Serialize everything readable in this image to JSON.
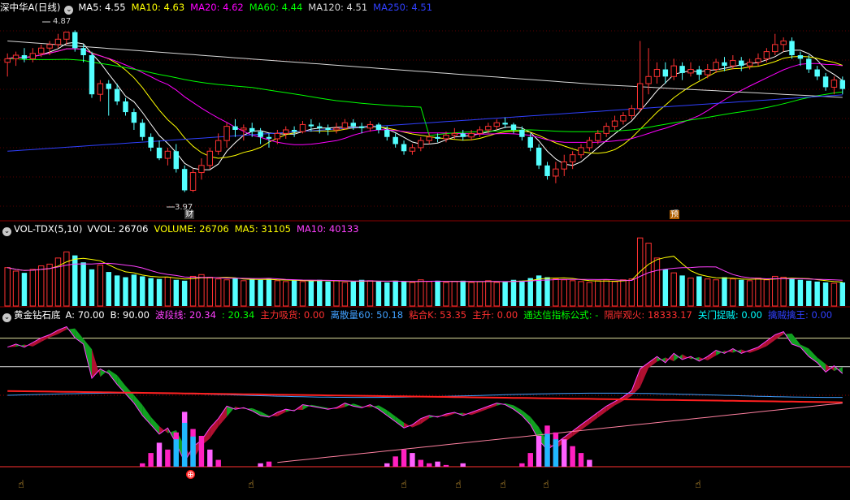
{
  "price_panel": {
    "title": "深中华A(日线)",
    "ma": [
      {
        "label": "MA5: 4.55",
        "color": "#ffffff"
      },
      {
        "label": "MA10: 4.63",
        "color": "#ffff00"
      },
      {
        "label": "MA20: 4.62",
        "color": "#ff00ff"
      },
      {
        "label": "MA60: 4.44",
        "color": "#00ff00"
      },
      {
        "label": "MA120: 4.51",
        "color": "#d8d8d8"
      },
      {
        "label": "MA250: 4.51",
        "color": "#3040ff"
      }
    ],
    "high_label": "4.87",
    "low_label": "3.97",
    "marker_cai": "财",
    "marker_yu": "预"
  },
  "volume_panel": {
    "name": "VOL-TDX(5,10)",
    "vvol": "VVOL: 26706",
    "volume": "VOLUME: 26706",
    "ma5": "MA5: 31105",
    "ma10": "MA10: 40133"
  },
  "indicator_panel": {
    "name": "黄金钻石底",
    "items": [
      {
        "label": "A: 70.00",
        "color": "#ffffff"
      },
      {
        "label": "B: 90.00",
        "color": "#ffffff"
      },
      {
        "label": "波段线: 20.34",
        "color": "#ff40ff"
      },
      {
        "label": ": 20.34",
        "color": "#00ff00"
      },
      {
        "label": "主力吸货: 0.00",
        "color": "#ff3030"
      },
      {
        "label": "离散量60: 50.18",
        "color": "#40a0ff"
      },
      {
        "label": "粘合K: 53.35",
        "color": "#ff3030"
      },
      {
        "label": "主升: 0.00",
        "color": "#ff3030"
      },
      {
        "label": "通达信指标公式: -",
        "color": "#00ff00"
      },
      {
        "label": "隔岸观火: 18333.17",
        "color": "#ff3030"
      },
      {
        "label": "关门捉贼: 0.00",
        "color": "#00ffff"
      },
      {
        "label": "擒贼擒王: 0.00",
        "color": "#3040ff"
      }
    ]
  },
  "colors": {
    "up": "#ff3232",
    "down": "#54ffff",
    "axis": "#8b0000"
  },
  "chart_data": {
    "type": "candlestick",
    "candles": [
      [
        4.7,
        4.72,
        4.62,
        4.75
      ],
      [
        4.72,
        4.74,
        4.68,
        4.76
      ],
      [
        4.74,
        4.72,
        4.7,
        4.78
      ],
      [
        4.72,
        4.75,
        4.7,
        4.78
      ],
      [
        4.75,
        4.78,
        4.73,
        4.8
      ],
      [
        4.78,
        4.8,
        4.74,
        4.82
      ],
      [
        4.8,
        4.83,
        4.78,
        4.86
      ],
      [
        4.83,
        4.87,
        4.8,
        4.87
      ],
      [
        4.87,
        4.78,
        4.76,
        4.88
      ],
      [
        4.78,
        4.74,
        4.7,
        4.8
      ],
      [
        4.74,
        4.52,
        4.5,
        4.76
      ],
      [
        4.52,
        4.58,
        4.48,
        4.6
      ],
      [
        4.58,
        4.55,
        4.4,
        4.6
      ],
      [
        4.55,
        4.48,
        4.46,
        4.58
      ],
      [
        4.48,
        4.42,
        4.4,
        4.5
      ],
      [
        4.42,
        4.36,
        4.32,
        4.44
      ],
      [
        4.36,
        4.28,
        4.26,
        4.38
      ],
      [
        4.28,
        4.22,
        4.2,
        4.3
      ],
      [
        4.22,
        4.16,
        4.15,
        4.26
      ],
      [
        4.16,
        4.2,
        4.12,
        4.22
      ],
      [
        4.2,
        4.1,
        4.08,
        4.24
      ],
      [
        4.1,
        3.98,
        3.97,
        4.12
      ],
      [
        3.98,
        4.08,
        3.97,
        4.1
      ],
      [
        4.08,
        4.12,
        4.04,
        4.16
      ],
      [
        4.12,
        4.2,
        4.1,
        4.22
      ],
      [
        4.2,
        4.26,
        4.18,
        4.3
      ],
      [
        4.26,
        4.34,
        4.22,
        4.36
      ],
      [
        4.34,
        4.32,
        4.28,
        4.38
      ],
      [
        4.32,
        4.33,
        4.26,
        4.35
      ],
      [
        4.33,
        4.31,
        4.28,
        4.36
      ],
      [
        4.31,
        4.28,
        4.24,
        4.33
      ],
      [
        4.28,
        4.27,
        4.22,
        4.3
      ],
      [
        4.27,
        4.3,
        4.24,
        4.32
      ],
      [
        4.3,
        4.32,
        4.27,
        4.34
      ],
      [
        4.32,
        4.31,
        4.28,
        4.34
      ],
      [
        4.31,
        4.35,
        4.3,
        4.37
      ],
      [
        4.35,
        4.34,
        4.31,
        4.38
      ],
      [
        4.34,
        4.33,
        4.3,
        4.36
      ],
      [
        4.33,
        4.32,
        4.29,
        4.35
      ],
      [
        4.32,
        4.33,
        4.3,
        4.36
      ],
      [
        4.33,
        4.36,
        4.32,
        4.38
      ],
      [
        4.36,
        4.34,
        4.32,
        4.38
      ],
      [
        4.34,
        4.33,
        4.3,
        4.36
      ],
      [
        4.33,
        4.35,
        4.31,
        4.37
      ],
      [
        4.35,
        4.32,
        4.3,
        4.36
      ],
      [
        4.32,
        4.28,
        4.26,
        4.34
      ],
      [
        4.28,
        4.24,
        4.22,
        4.3
      ],
      [
        4.24,
        4.2,
        4.18,
        4.26
      ],
      [
        4.2,
        4.22,
        4.18,
        4.24
      ],
      [
        4.22,
        4.26,
        4.2,
        4.28
      ],
      [
        4.26,
        4.28,
        4.24,
        4.3
      ],
      [
        4.28,
        4.27,
        4.25,
        4.3
      ],
      [
        4.27,
        4.29,
        4.25,
        4.31
      ],
      [
        4.29,
        4.3,
        4.27,
        4.33
      ],
      [
        4.3,
        4.28,
        4.26,
        4.32
      ],
      [
        4.28,
        4.3,
        4.26,
        4.32
      ],
      [
        4.3,
        4.32,
        4.28,
        4.34
      ],
      [
        4.32,
        4.34,
        4.3,
        4.36
      ],
      [
        4.34,
        4.36,
        4.32,
        4.38
      ],
      [
        4.36,
        4.35,
        4.33,
        4.39
      ],
      [
        4.35,
        4.32,
        4.3,
        4.36
      ],
      [
        4.32,
        4.28,
        4.26,
        4.34
      ],
      [
        4.28,
        4.22,
        4.2,
        4.3
      ],
      [
        4.22,
        4.12,
        4.1,
        4.24
      ],
      [
        4.12,
        4.06,
        4.04,
        4.14
      ],
      [
        4.06,
        4.1,
        4.02,
        4.14
      ],
      [
        4.1,
        4.14,
        4.06,
        4.18
      ],
      [
        4.14,
        4.18,
        4.1,
        4.2
      ],
      [
        4.18,
        4.22,
        4.16,
        4.24
      ],
      [
        4.22,
        4.26,
        4.2,
        4.28
      ],
      [
        4.26,
        4.3,
        4.24,
        4.32
      ],
      [
        4.3,
        4.34,
        4.28,
        4.36
      ],
      [
        4.34,
        4.37,
        4.32,
        4.4
      ],
      [
        4.37,
        4.4,
        4.35,
        4.42
      ],
      [
        4.4,
        4.44,
        4.38,
        4.46
      ],
      [
        4.44,
        4.58,
        4.42,
        4.82
      ],
      [
        4.58,
        4.62,
        4.52,
        4.78
      ],
      [
        4.62,
        4.66,
        4.58,
        4.7
      ],
      [
        4.66,
        4.62,
        4.58,
        4.7
      ],
      [
        4.62,
        4.68,
        4.6,
        4.72
      ],
      [
        4.68,
        4.64,
        4.6,
        4.7
      ],
      [
        4.64,
        4.66,
        4.62,
        4.7
      ],
      [
        4.66,
        4.63,
        4.6,
        4.68
      ],
      [
        4.63,
        4.66,
        4.61,
        4.69
      ],
      [
        4.66,
        4.7,
        4.64,
        4.72
      ],
      [
        4.7,
        4.68,
        4.65,
        4.73
      ],
      [
        4.68,
        4.71,
        4.66,
        4.74
      ],
      [
        4.71,
        4.68,
        4.65,
        4.73
      ],
      [
        4.68,
        4.7,
        4.66,
        4.72
      ],
      [
        4.7,
        4.72,
        4.68,
        4.75
      ],
      [
        4.72,
        4.76,
        4.7,
        4.78
      ],
      [
        4.76,
        4.8,
        4.74,
        4.86
      ],
      [
        4.8,
        4.82,
        4.76,
        4.84
      ],
      [
        4.82,
        4.74,
        4.72,
        4.84
      ],
      [
        4.74,
        4.72,
        4.68,
        4.76
      ],
      [
        4.72,
        4.66,
        4.64,
        4.74
      ],
      [
        4.66,
        4.62,
        4.6,
        4.68
      ],
      [
        4.62,
        4.56,
        4.54,
        4.64
      ],
      [
        4.56,
        4.6,
        4.52,
        4.62
      ],
      [
        4.6,
        4.55,
        4.52,
        4.62
      ]
    ],
    "volumes": [
      44,
      40,
      38,
      42,
      46,
      48,
      55,
      62,
      58,
      50,
      42,
      47,
      39,
      35,
      33,
      36,
      34,
      32,
      31,
      33,
      30,
      29,
      34,
      36,
      33,
      31,
      30,
      32,
      29,
      31,
      30,
      31,
      29,
      28,
      30,
      28,
      29,
      30,
      28,
      29,
      27,
      28,
      30,
      29,
      28,
      27,
      29,
      28,
      27,
      30,
      28,
      29,
      27,
      28,
      29,
      27,
      28,
      29,
      27,
      28,
      30,
      29,
      32,
      35,
      33,
      31,
      30,
      29,
      28,
      27,
      29,
      30,
      28,
      30,
      31,
      78,
      72,
      55,
      42,
      38,
      35,
      32,
      34,
      31,
      30,
      33,
      31,
      30,
      29,
      32,
      30,
      34,
      33,
      31,
      30,
      29,
      28,
      27,
      26,
      27
    ]
  }
}
